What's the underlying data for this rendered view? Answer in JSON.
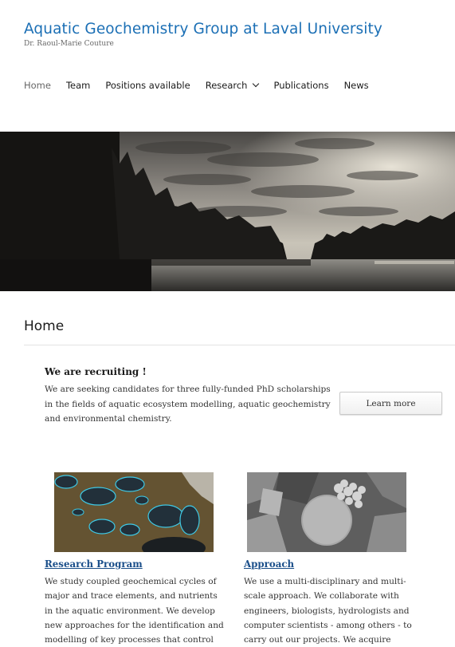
{
  "site": {
    "title": "Aquatic Geochemistry Group at Laval University",
    "description": "Dr. Raoul-Marie Couture"
  },
  "nav": {
    "items": [
      {
        "label": "Home",
        "active": true
      },
      {
        "label": "Team"
      },
      {
        "label": "Positions available"
      },
      {
        "label": "Research",
        "has_submenu": true
      },
      {
        "label": "Publications"
      },
      {
        "label": "News"
      }
    ]
  },
  "page": {
    "title": "Home"
  },
  "recruit": {
    "title": "We are recruiting !",
    "text": "We are seeking candidates for three fully-funded PhD scholarships in the fields of aquatic ecosystem modelling, aquatic geochemistry and environmental chemistry.",
    "button_label": "Learn more"
  },
  "columns": {
    "left": {
      "title": "Research Program",
      "text": "We study coupled geochemical cycles of major and trace elements, and nutrients in the aquatic environment. We develop new approaches for the identification and modelling of key processes that control"
    },
    "right": {
      "title": "Approach",
      "text": "We use a multi-disciplinary and multi-scale approach. We collaborate with engineers, biologists, hydrologists and computer scientists - among others - to carry out our projects. We acquire"
    }
  },
  "colors": {
    "brand": "#1b6fb5",
    "link": "#1b4f8a"
  }
}
